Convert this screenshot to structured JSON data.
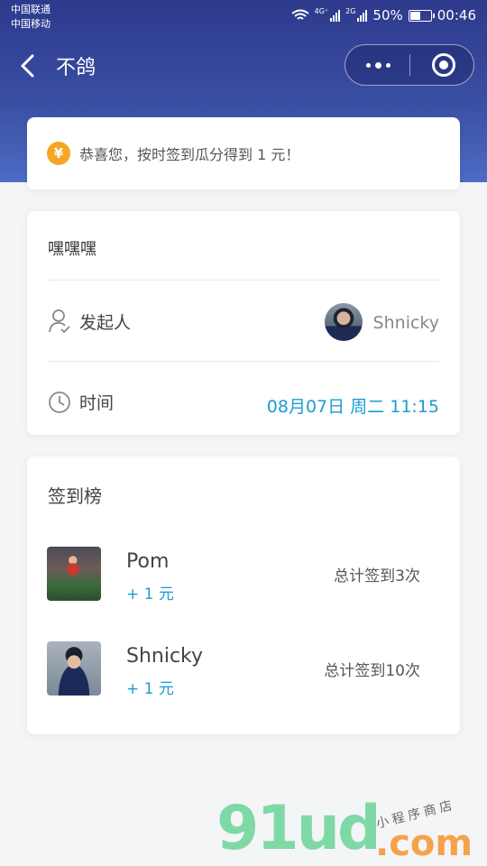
{
  "status_bar": {
    "carrier_1": "中国联通",
    "carrier_2": "中国移动",
    "net_1": "4G⁺",
    "net_2": "2G",
    "battery": "50%",
    "time": "00:46"
  },
  "nav": {
    "title": "不鸽"
  },
  "notice": {
    "icon": "¥",
    "text": "恭喜您，按时签到瓜分得到 1 元！"
  },
  "event": {
    "title": "嘿嘿嘿",
    "initiator_label": "发起人",
    "initiator_name": "Shnicky",
    "time_label": "时间",
    "time_value": "08月07日 周二 11:15"
  },
  "board": {
    "title": "签到榜",
    "members": [
      {
        "name": "Pom",
        "reward": "+ 1 元",
        "total": "总计签到3次"
      },
      {
        "name": "Shnicky",
        "reward": "+ 1 元",
        "total": "总计签到10次"
      }
    ]
  },
  "watermark": {
    "logo": "91ud",
    "domain": ".com",
    "tagline": "小程序商店"
  },
  "colors": {
    "header": "#2d3a8c",
    "accent_blue": "#1d9bd1",
    "yen_orange": "#f5a623"
  }
}
